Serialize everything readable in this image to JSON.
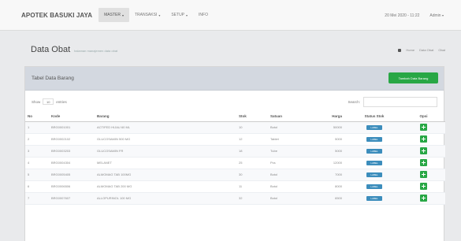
{
  "navbar": {
    "brand": "APOTEK BASUKI JAYA",
    "menu": [
      {
        "label": "MASTER",
        "active": true,
        "dropdown": true
      },
      {
        "label": "TRANSAKSI",
        "active": false,
        "dropdown": true
      },
      {
        "label": "SETUP",
        "active": false,
        "dropdown": true
      },
      {
        "label": "INFO",
        "active": false,
        "dropdown": false
      }
    ],
    "datetime": "20 Mei 2020 - 11:22",
    "user": "Admin"
  },
  "header": {
    "title": "Data Obat",
    "subtitle": "halaman manajemen data obat",
    "breadcrumb": [
      "Home",
      "Data Obat",
      "Obat"
    ]
  },
  "panel": {
    "title": "Tabel Data Barang",
    "add_button": "Tambah Data Barang"
  },
  "controls": {
    "show_label": "Show",
    "page_size": "10",
    "entries_label": "entries",
    "search_label": "Search:",
    "search_value": ""
  },
  "table": {
    "headers": [
      "No",
      "Kode",
      "Barang",
      "Stok",
      "Satuan",
      "Harga",
      "Status Stok",
      "Opsi"
    ],
    "rows": [
      {
        "no": "1",
        "kode": "BRG0001001",
        "barang": "ACTIFED HIJAU 60 ML",
        "stok": "10",
        "satuan": "Botol",
        "harga": "50000",
        "status": "LABEL"
      },
      {
        "no": "2",
        "kode": "BRG0002102",
        "barang": "GLUCOSAMIN 500 MG",
        "stok": "12",
        "satuan": "Tablet",
        "harga": "5000",
        "status": "LABEL"
      },
      {
        "no": "3",
        "kode": "BRG0003203",
        "barang": "GLUCOSAMIN FR",
        "stok": "18",
        "satuan": "Tube",
        "harga": "5000",
        "status": "LABEL"
      },
      {
        "no": "4",
        "kode": "BRG0004304",
        "barang": "MELANET",
        "stok": "25",
        "satuan": "Pcs",
        "harga": "12000",
        "status": "LABEL"
      },
      {
        "no": "5",
        "kode": "BRG0005405",
        "barang": "ALMOMAG TAB 100MG",
        "stok": "30",
        "satuan": "Botol",
        "harga": "7000",
        "status": "LABEL"
      },
      {
        "no": "6",
        "kode": "BRG0006506",
        "barang": "ALMOMAG TAB 200 MG",
        "stok": "11",
        "satuan": "Botol",
        "harga": "8000",
        "status": "LABEL"
      },
      {
        "no": "7",
        "kode": "BRG0007607",
        "barang": "ALLOPURINOL 100 MG",
        "stok": "32",
        "satuan": "Botol",
        "harga": "6500",
        "status": "LABEL"
      }
    ]
  },
  "colors": {
    "primary": "#3c8dbc",
    "success": "#28a745",
    "panel_header": "#d3d8e0"
  },
  "icons": {
    "home": "home-icon",
    "add": "plus-icon"
  }
}
